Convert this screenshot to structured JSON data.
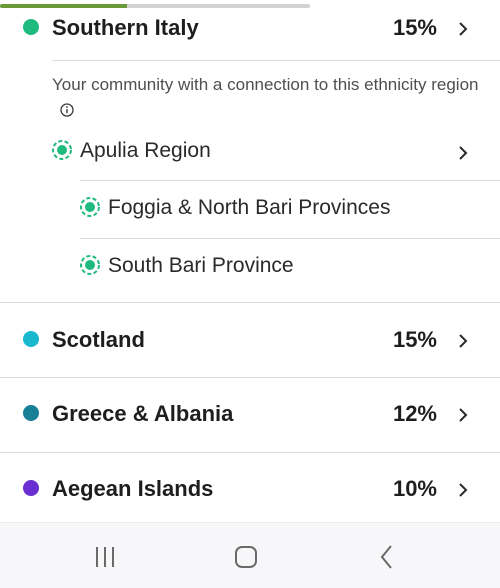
{
  "progress": {
    "fraction": 0.41,
    "fill_color": "#6a9a38",
    "track_color": "#d2d2d2"
  },
  "regions": [
    {
      "name": "Southern Italy",
      "percent": "15%",
      "color": "#1fba7e"
    },
    {
      "name": "Scotland",
      "percent": "15%",
      "color": "#18b8cf"
    },
    {
      "name": "Greece & Albania",
      "percent": "12%",
      "color": "#177f98"
    },
    {
      "name": "Aegean Islands",
      "percent": "10%",
      "color": "#6a2fd1"
    }
  ],
  "community": {
    "text": "Your community with a connection to this ethnicity region",
    "info_icon": "info-icon",
    "subregions": [
      {
        "name": "Apulia Region",
        "icon": "community-icon"
      },
      {
        "name": "Foggia & North Bari Provinces",
        "icon": "community-icon"
      },
      {
        "name": "South Bari Province",
        "icon": "community-icon"
      }
    ]
  },
  "nav": {
    "recent_apps_icon": "recent-apps-icon",
    "home_icon": "home-icon",
    "back_icon": "back-icon"
  },
  "accent_color": "#1fba7e"
}
